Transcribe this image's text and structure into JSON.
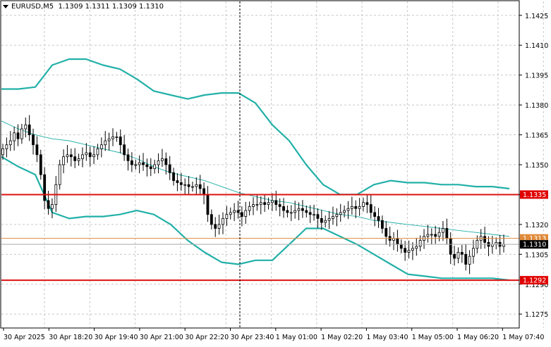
{
  "header": {
    "symbol": "EURUSD,M5",
    "ohlc": "1.1309 1.1311 1.1309 1.1310"
  },
  "price_axis": {
    "ticks": [
      "1.1425",
      "1.1410",
      "1.1395",
      "1.1380",
      "1.1365",
      "1.1350",
      "1.1335",
      "1.1320",
      "1.1305",
      "1.1290",
      "1.1275"
    ],
    "tick_values": [
      1.1425,
      1.141,
      1.1395,
      1.138,
      1.1365,
      1.135,
      1.1335,
      1.132,
      1.1305,
      1.129,
      1.1275
    ]
  },
  "time_axis": {
    "labels": [
      "30 Apr 2025",
      "30 Apr 18:20",
      "30 Apr 19:40",
      "30 Apr 21:00",
      "30 Apr 22:20",
      "30 Apr 23:40",
      "1 May 01:00",
      "1 May 02:20",
      "1 May 03:40",
      "1 May 05:00",
      "1 May 06:20",
      "1 May 07:40"
    ]
  },
  "price_tags": [
    {
      "label": "1.1335",
      "value": 1.1335,
      "color": "#e00000",
      "kind": "horizontal-level"
    },
    {
      "label": "1.1313",
      "value": 1.1313,
      "color": "#e08a3a",
      "kind": "ask-line"
    },
    {
      "label": "1.1310",
      "value": 1.131,
      "color": "#000000",
      "kind": "bid-line"
    },
    {
      "label": "1.1292",
      "value": 1.1292,
      "color": "#e00000",
      "kind": "horizontal-level"
    }
  ],
  "colors": {
    "band": "#22b0a8",
    "middle": "#22b0a8",
    "level": "#dd1111",
    "ask": "#e08a3a",
    "bid": "#aaaaaa",
    "candle": "#000000",
    "grid": "#c8c8c8"
  },
  "chart_data": {
    "type": "candlestick",
    "title": "EURUSD,M5",
    "ylim": [
      1.1268,
      1.1432
    ],
    "indicator": "bollinger-bands",
    "crosshair_time": "30 Apr 23:40",
    "closes": [
      1.1358,
      1.136,
      1.1362,
      1.1366,
      1.1363,
      1.1368,
      1.137,
      1.1365,
      1.136,
      1.1355,
      1.1345,
      1.1332,
      1.1328,
      1.133,
      1.134,
      1.135,
      1.1354,
      1.1355,
      1.1354,
      1.1352,
      1.1353,
      1.1355,
      1.1356,
      1.1354,
      1.1355,
      1.1358,
      1.136,
      1.1362,
      1.1363,
      1.1364,
      1.1364,
      1.136,
      1.1355,
      1.1352,
      1.135,
      1.135,
      1.1351,
      1.135,
      1.1349,
      1.1348,
      1.135,
      1.1352,
      1.1353,
      1.135,
      1.1346,
      1.1342,
      1.1341,
      1.134,
      1.134,
      1.1339,
      1.1339,
      1.134,
      1.1338,
      1.1335,
      1.1325,
      1.132,
      1.1318,
      1.132,
      1.1323,
      1.1325,
      1.1326,
      1.1327,
      1.1326,
      1.1324,
      1.1327,
      1.1329,
      1.133,
      1.133,
      1.1331,
      1.133,
      1.1331,
      1.1332,
      1.133,
      1.1329,
      1.1327,
      1.1326,
      1.1326,
      1.1327,
      1.1328,
      1.1327,
      1.1326,
      1.1325,
      1.1325,
      1.1323,
      1.1321,
      1.1322,
      1.1323,
      1.1324,
      1.1325,
      1.1326,
      1.1327,
      1.1328,
      1.1329,
      1.1328,
      1.1329,
      1.1331,
      1.133,
      1.1326,
      1.1324,
      1.1322,
      1.1318,
      1.1314,
      1.1312,
      1.1313,
      1.131,
      1.1308,
      1.1306,
      1.1307,
      1.1308,
      1.1309,
      1.1312,
      1.1314,
      1.1315,
      1.1315,
      1.1314,
      1.1316,
      1.1318,
      1.1313,
      1.1305,
      1.1303,
      1.1306,
      1.1305,
      1.13,
      1.1304,
      1.1308,
      1.1312,
      1.1314,
      1.1311,
      1.1309,
      1.131,
      1.1311,
      1.1309,
      1.131
    ],
    "bands": {
      "upper": [
        1.1388,
        1.1388,
        1.1389,
        1.14,
        1.1403,
        1.1403,
        1.14,
        1.1398,
        1.1393,
        1.1387,
        1.1385,
        1.1383,
        1.1385,
        1.1386,
        1.1386,
        1.1381,
        1.137,
        1.1362,
        1.135,
        1.134,
        1.1335,
        1.1335,
        1.134,
        1.1342,
        1.1341,
        1.1341,
        1.134,
        1.134,
        1.1339,
        1.1339,
        1.1338
      ],
      "lower": [
        1.1354,
        1.1349,
        1.1345,
        1.1326,
        1.1323,
        1.1324,
        1.1324,
        1.1325,
        1.1327,
        1.1325,
        1.132,
        1.1312,
        1.1306,
        1.1301,
        1.13,
        1.1302,
        1.1302,
        1.131,
        1.1318,
        1.1318,
        1.1314,
        1.131,
        1.1305,
        1.13,
        1.1295,
        1.1294,
        1.1293,
        1.1293,
        1.1293,
        1.1293,
        1.1292
      ],
      "middle": [
        1.1372,
        1.1368,
        1.1365,
        1.1363,
        1.1362,
        1.136,
        1.1358,
        1.1356,
        1.1353,
        1.1349,
        1.1346,
        1.1344,
        1.1342,
        1.1339,
        1.1336,
        1.1334,
        1.1332,
        1.1331,
        1.1329,
        1.1327,
        1.1325,
        1.1324,
        1.1322,
        1.1321,
        1.132,
        1.1319,
        1.1318,
        1.1317,
        1.1316,
        1.1315,
        1.1314
      ]
    }
  }
}
